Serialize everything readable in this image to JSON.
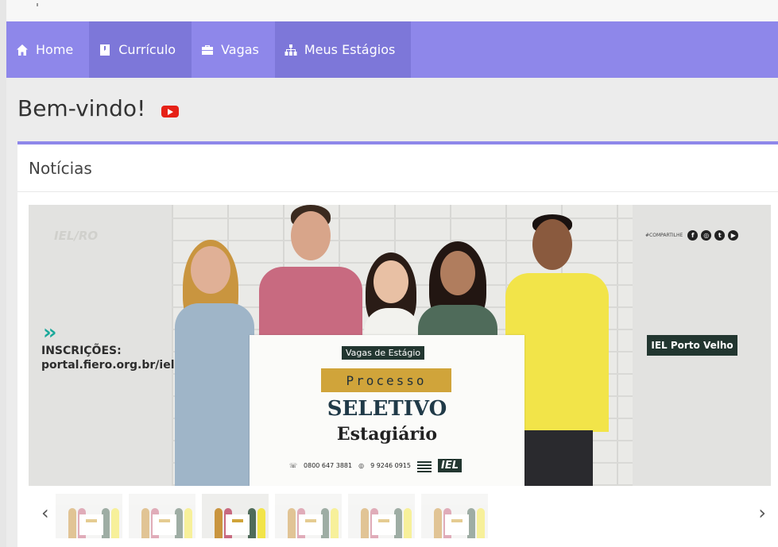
{
  "nav": {
    "items": [
      {
        "label": "Home",
        "icon": "home-icon"
      },
      {
        "label": "Currículo",
        "icon": "document-icon"
      },
      {
        "label": "Vagas",
        "icon": "briefcase-icon"
      },
      {
        "label": "Meus Estágios",
        "icon": "sitemap-icon"
      }
    ]
  },
  "welcome": {
    "title": "Bem-vindo!",
    "icon": "youtube-icon"
  },
  "panel": {
    "title": "Notícias"
  },
  "banner": {
    "watermark": "IEL/RO",
    "inscricoes_label": "INSCRIÇÕES:",
    "inscricoes_url": "portal.fiero.org.br/iel",
    "share_label": "#COMPARTILHE",
    "location_tag": "IEL Porto Velho",
    "sign": {
      "badge": "Vagas de Estágio",
      "line1": "Processo",
      "line2": "SELETIVO",
      "line3": "Estagiário",
      "phone1": "0800 647 3881",
      "phone2": "9 9246 0915",
      "logo": "IEL"
    }
  },
  "carousel": {
    "prev": "‹",
    "next": "›",
    "active_index": 2,
    "count": 6
  },
  "colors": {
    "nav": "#8e87ea",
    "accent_gold": "#d0a43a",
    "iel_dark": "#223630",
    "youtube": "#e62117"
  }
}
